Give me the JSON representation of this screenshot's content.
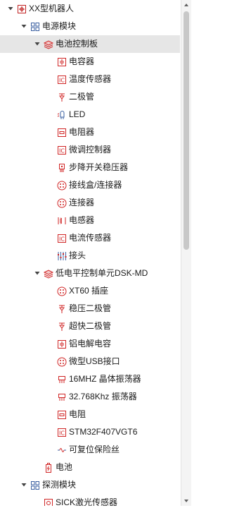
{
  "tree": {
    "items": [
      {
        "label": "XX型机器人",
        "icon": "robot-root-icon",
        "expanded": true,
        "depth": 0
      },
      {
        "label": "电源模块",
        "icon": "module-grid-icon",
        "expanded": true,
        "depth": 1
      },
      {
        "label": "电池控制板",
        "icon": "board-stack-icon",
        "expanded": true,
        "depth": 2,
        "selected": true
      },
      {
        "label": "电容器",
        "icon": "capacitor-icon",
        "depth": 3
      },
      {
        "label": "温度传感器",
        "icon": "ic-chip-icon",
        "depth": 3
      },
      {
        "label": "二极管",
        "icon": "diode-icon",
        "depth": 3
      },
      {
        "label": "LED",
        "icon": "led-icon",
        "depth": 3
      },
      {
        "label": "电阻器",
        "icon": "resistor-icon",
        "depth": 3
      },
      {
        "label": "微调控制器",
        "icon": "ic-chip-icon",
        "depth": 3
      },
      {
        "label": "步降开关稳压器",
        "icon": "regulator-icon",
        "depth": 3
      },
      {
        "label": "接线盒/连接器",
        "icon": "connector-icon",
        "depth": 3
      },
      {
        "label": "连接器",
        "icon": "connector-icon",
        "depth": 3
      },
      {
        "label": "电感器",
        "icon": "inductor-icon",
        "depth": 3
      },
      {
        "label": "电流传感器",
        "icon": "ic-chip-icon",
        "depth": 3
      },
      {
        "label": "接头",
        "icon": "header-icon",
        "depth": 3
      },
      {
        "label": "低电平控制单元DSK-MD",
        "icon": "board-stack-icon",
        "expanded": true,
        "depth": 2
      },
      {
        "label": "XT60 插座",
        "icon": "connector-icon",
        "depth": 3
      },
      {
        "label": "稳压二极管",
        "icon": "diode-icon",
        "depth": 3
      },
      {
        "label": "超快二极管",
        "icon": "diode-icon",
        "depth": 3
      },
      {
        "label": "铝电解电容",
        "icon": "capacitor-icon",
        "depth": 3
      },
      {
        "label": "微型USB接口",
        "icon": "connector-icon",
        "depth": 3
      },
      {
        "label": "16MHZ 晶体振荡器",
        "icon": "crystal-icon",
        "depth": 3
      },
      {
        "label": "32.768Khz 振荡器",
        "icon": "crystal-icon",
        "depth": 3
      },
      {
        "label": "电阻",
        "icon": "resistor-icon",
        "depth": 3
      },
      {
        "label": "STM32F407VGT6",
        "icon": "ic-chip-icon",
        "depth": 3
      },
      {
        "label": "可复位保险丝",
        "icon": "fuse-icon",
        "depth": 3
      },
      {
        "label": "电池",
        "icon": "battery-icon",
        "depth": 2
      },
      {
        "label": "探测模块",
        "icon": "module-grid-icon",
        "expanded": true,
        "depth": 1
      },
      {
        "label": "SICK激光传感器",
        "icon": "sensor-icon",
        "depth": 2
      }
    ]
  },
  "colors": {
    "accent": "#d02525",
    "grid": "#3a5fa0",
    "selected_bg": "#e6e6e6"
  }
}
